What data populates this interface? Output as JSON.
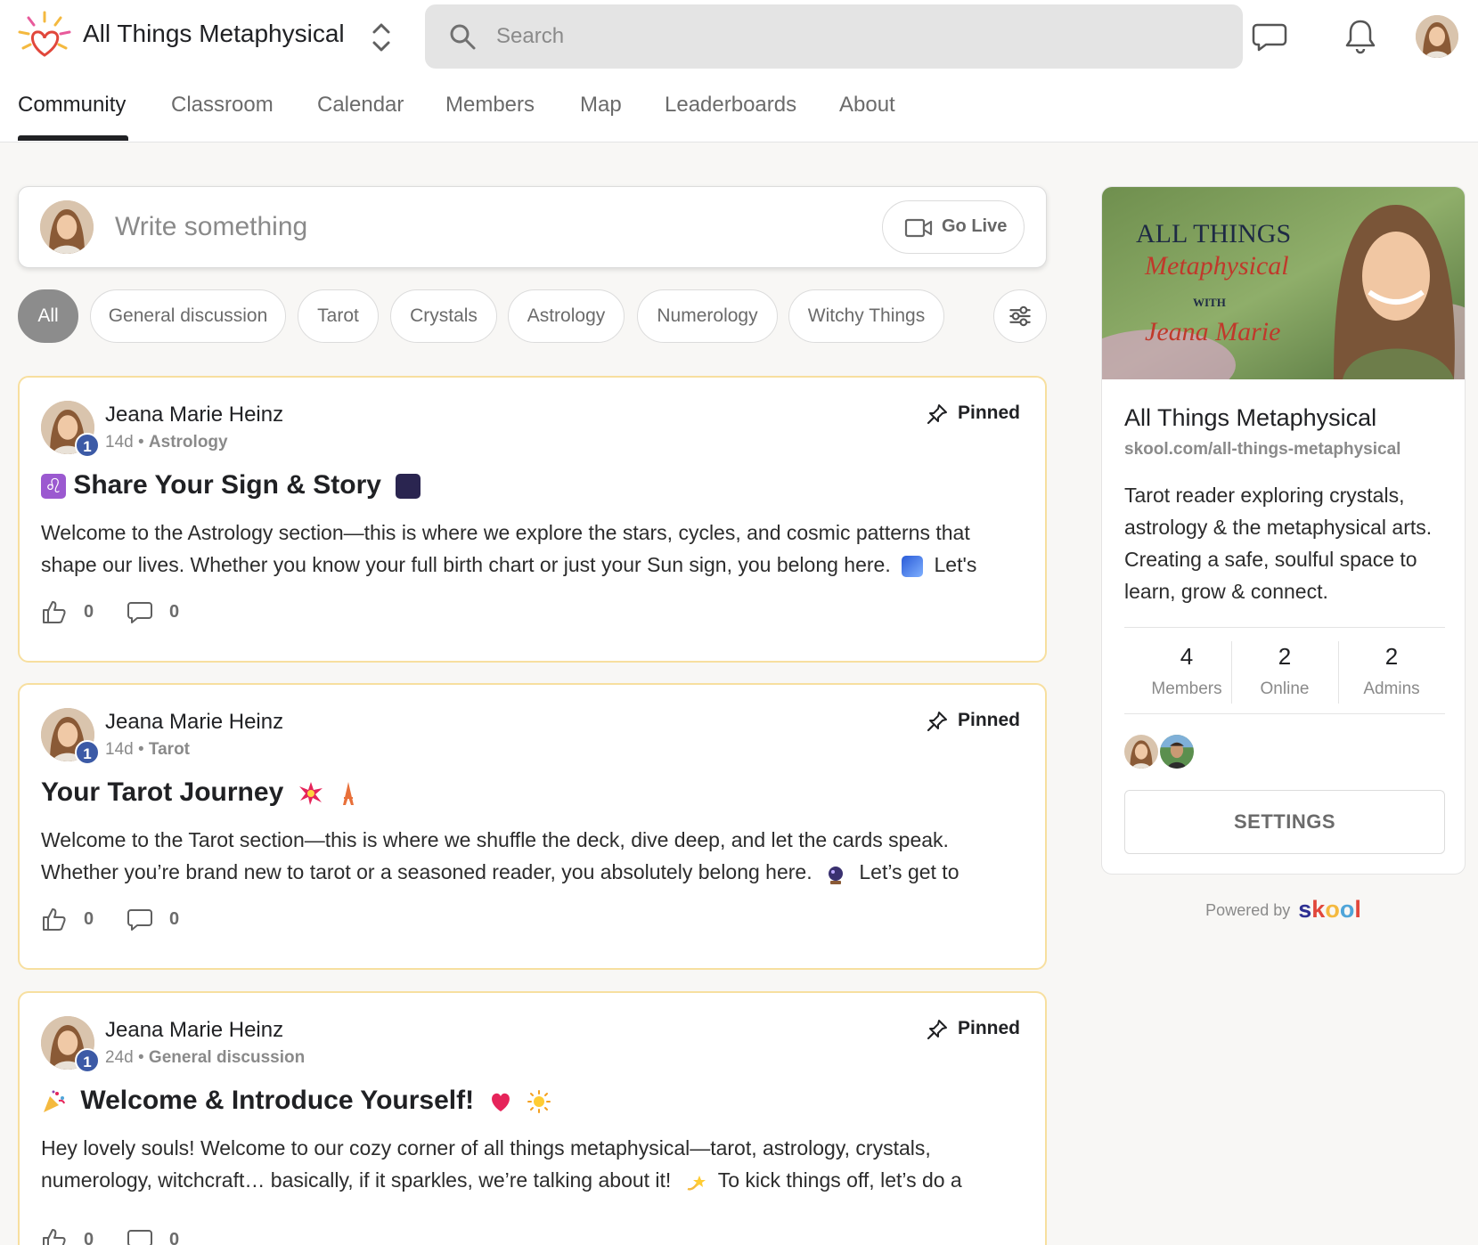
{
  "header": {
    "group_name": "All Things Metaphysical",
    "search_placeholder": "Search",
    "icons": [
      "logo-icon",
      "switcher-icon",
      "search-icon",
      "chat-icon",
      "bell-icon",
      "avatar"
    ]
  },
  "tabs": [
    "Community",
    "Classroom",
    "Calendar",
    "Members",
    "Map",
    "Leaderboards",
    "About"
  ],
  "active_tab": "Community",
  "composer": {
    "placeholder": "Write something",
    "go_live_label": "Go Live"
  },
  "filters": [
    "All",
    "General discussion",
    "Tarot",
    "Crystals",
    "Astrology",
    "Numerology",
    "Witchy Things"
  ],
  "active_filter": "All",
  "posts": [
    {
      "author": "Jeana Marie Heinz",
      "level": "1",
      "age": "14d",
      "category": "Astrology",
      "pinned_label": "Pinned",
      "title": "Share Your Sign & Story",
      "title_emoji_before": "leo-emoji",
      "title_emoji_after": "night-sky-emoji",
      "body": "Welcome to the Astrology section—this is where we explore the stars, cycles, and cosmic patterns that shape our lives. Whether you know your full birth chart or just your Sun sign, you belong here.",
      "body_end": "Let's",
      "body_emoji": "comet-emoji",
      "likes": "0",
      "comments": "0"
    },
    {
      "author": "Jeana Marie Heinz",
      "level": "1",
      "age": "14d",
      "category": "Tarot",
      "pinned_label": "Pinned",
      "title": "Your Tarot Journey",
      "title_emoji_after_1": "sparkle-burst-emoji",
      "title_emoji_after_2": "tower-emoji",
      "body": "Welcome to the Tarot section—this is where we shuffle the deck, dive deep, and let the cards speak. Whether you’re brand new to tarot or a seasoned reader, you absolutely belong here.",
      "body_end": "Let’s get to",
      "body_emoji": "crystal-ball-emoji",
      "likes": "0",
      "comments": "0"
    },
    {
      "author": "Jeana Marie Heinz",
      "level": "1",
      "age": "24d",
      "category": "General discussion",
      "pinned_label": "Pinned",
      "title": "Welcome & Introduce Yourself!",
      "title_emoji_before": "party-popper-emoji",
      "title_emoji_after_1": "heart-emoji",
      "title_emoji_after_2": "sun-emoji",
      "body": "Hey lovely souls! Welcome to our cozy corner of all things metaphysical—tarot, astrology, crystals, numerology, witchcraft… basically, if it sparkles, we’re talking about it!",
      "body_end": "To kick things off, let’s do a",
      "body_emoji": "dizzy-emoji",
      "likes": "0",
      "comments": "0"
    }
  ],
  "sidebar": {
    "cover_text_1": "ALL THINGS",
    "cover_text_2": "Metaphysical",
    "cover_text_3": "WITH",
    "cover_text_4": "Jeana Marie",
    "title": "All Things Metaphysical",
    "url": "skool.com/all-things-metaphysical",
    "description": "Tarot reader exploring crystals, astrology & the metaphysical arts. Creating a safe, soulful space to learn, grow & connect.",
    "stats": [
      {
        "value": "4",
        "label": "Members"
      },
      {
        "value": "2",
        "label": "Online"
      },
      {
        "value": "2",
        "label": "Admins"
      }
    ],
    "settings_label": "SETTINGS"
  },
  "powered_by": {
    "label": "Powered by",
    "brand_letters": [
      "s",
      "k",
      "o",
      "o",
      "l"
    ],
    "brand_colors": [
      "#2e3092",
      "#e1473b",
      "#f4b93f",
      "#4fa5d9",
      "#e1473b"
    ]
  },
  "colors": {
    "badge": "#3c5aa6",
    "post_border": "#f7df9f",
    "chip_active": "#8c8c8c"
  }
}
